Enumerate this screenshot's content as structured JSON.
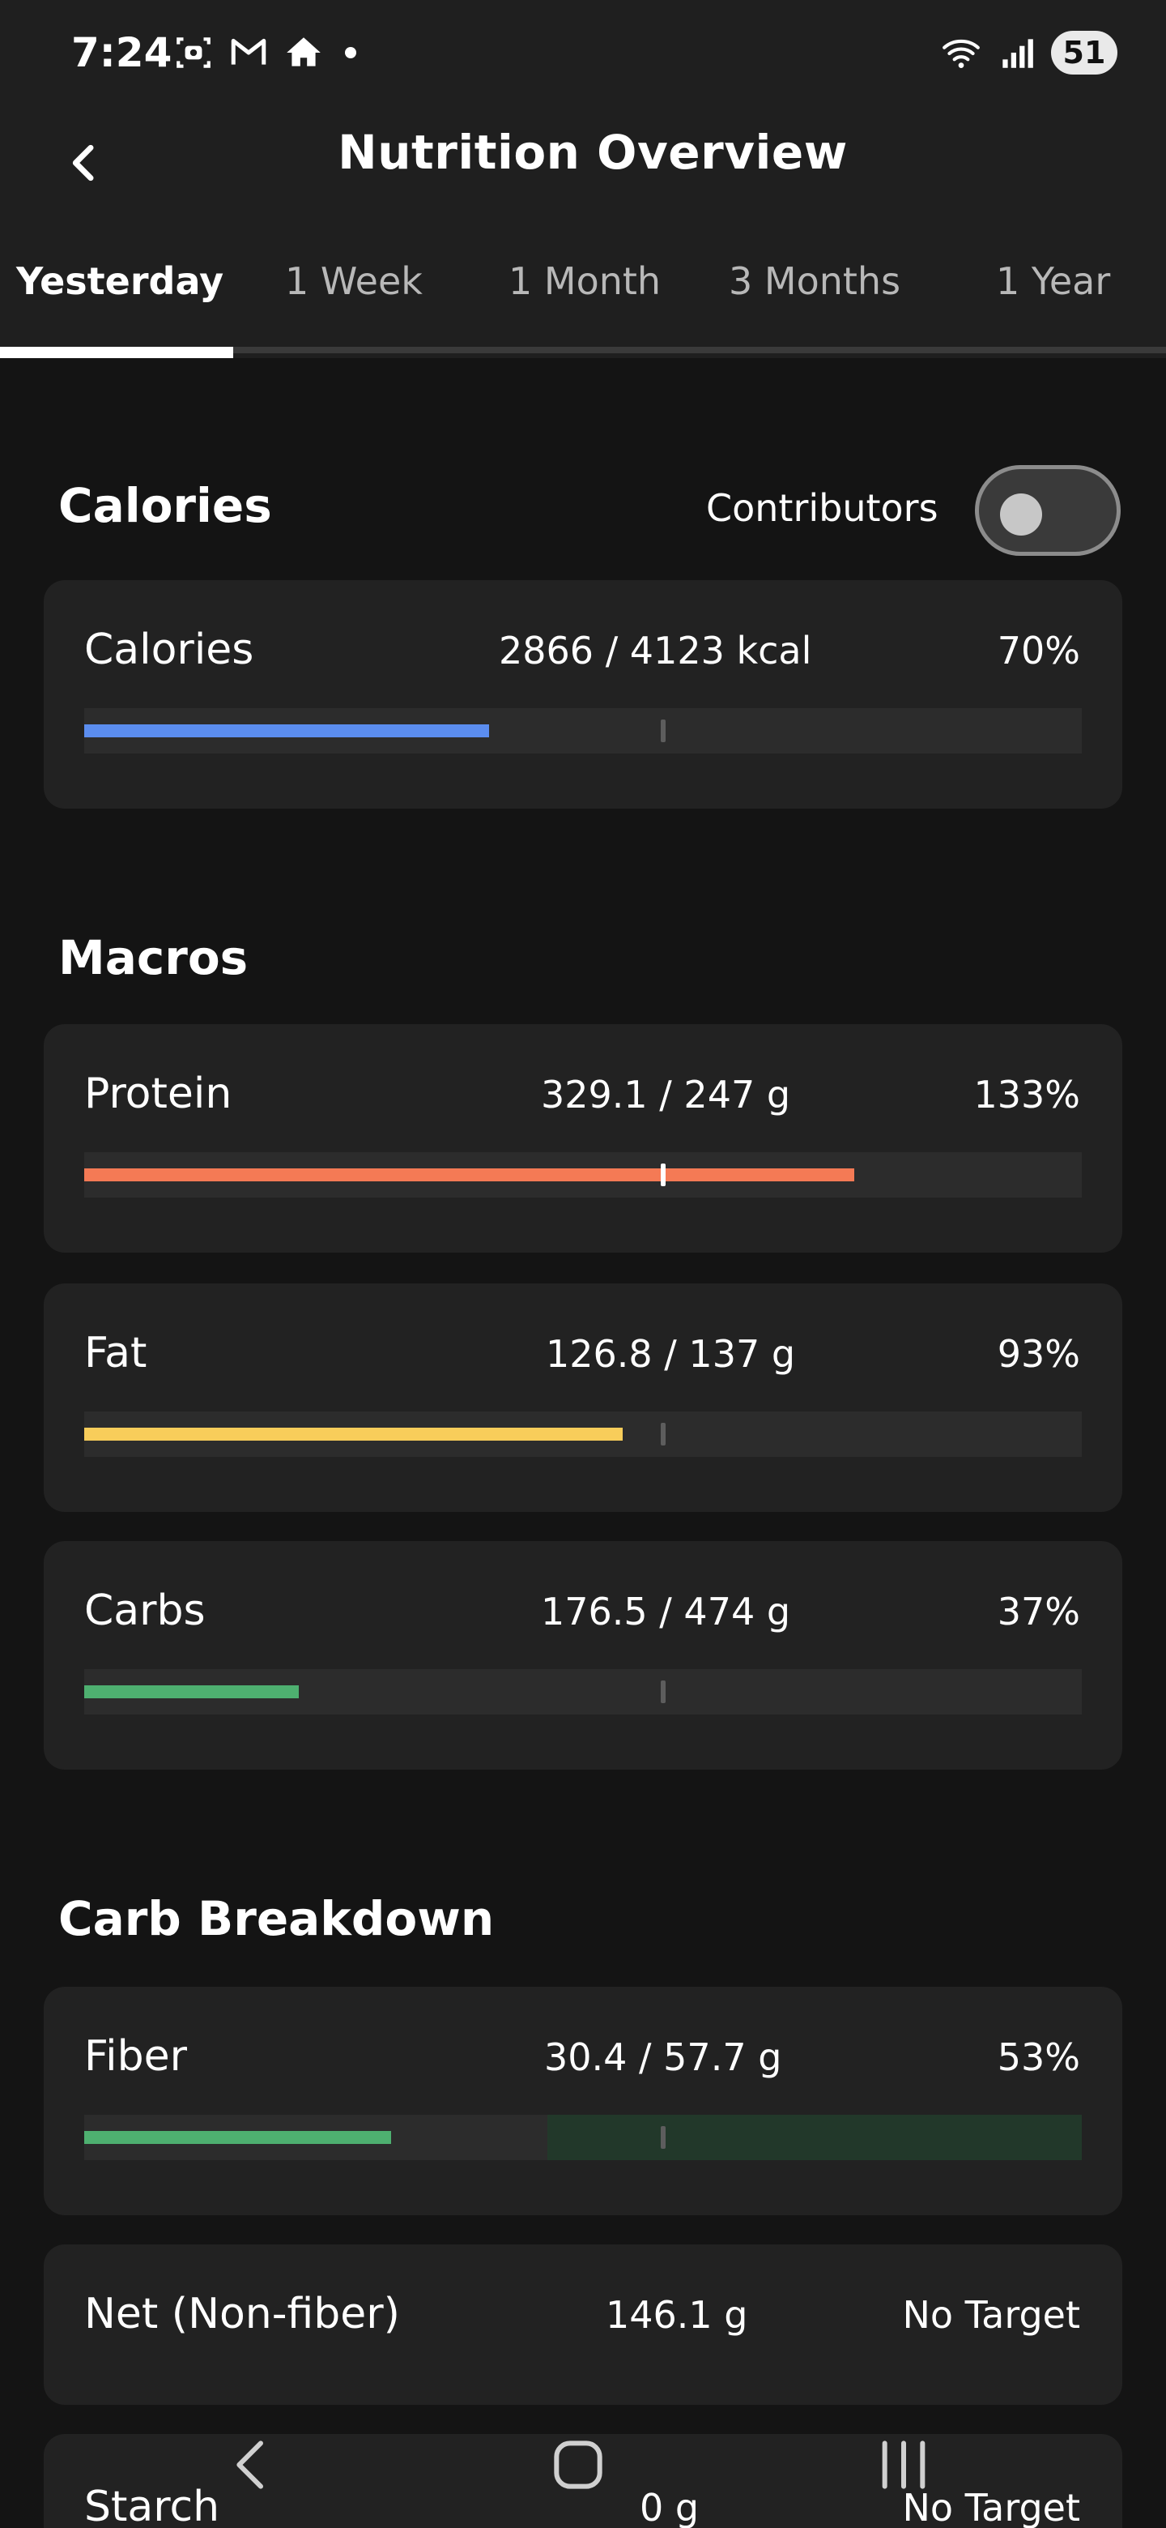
{
  "status_bar": {
    "time": "7:24",
    "left_icons": [
      "screenshot-icon",
      "gmail-icon",
      "home-icon",
      "notification-dot"
    ],
    "right_icons": [
      "wifi-icon",
      "signal-icon"
    ],
    "battery": "51"
  },
  "header": {
    "title": "Nutrition Overview",
    "back_icon": "chevron-left-icon"
  },
  "tabs": [
    {
      "label": "Yesterday",
      "active": true
    },
    {
      "label": "1 Week",
      "active": false
    },
    {
      "label": "1 Month",
      "active": false
    },
    {
      "label": "3 Months",
      "active": false
    },
    {
      "label": "1 Year",
      "active": false
    }
  ],
  "calories_section": {
    "title": "Calories",
    "contributors_label": "Contributors",
    "contributors_on": false,
    "card": {
      "name": "Calories",
      "value": "2866 / 4123 kcal",
      "percent": "70%",
      "fill_fraction": 0.7,
      "color": "#5b8def"
    }
  },
  "macros_section": {
    "title": "Macros",
    "items": [
      {
        "name": "Protein",
        "value": "329.1 / 247 g",
        "percent": "133%",
        "fill_fraction": 1.33,
        "color": "#f47a55"
      },
      {
        "name": "Fat",
        "value": "126.8 / 137 g",
        "percent": "93%",
        "fill_fraction": 0.93,
        "color": "#f8cd5a"
      },
      {
        "name": "Carbs",
        "value": "176.5 / 474 g",
        "percent": "37%",
        "fill_fraction": 0.37,
        "color": "#4eb070"
      }
    ]
  },
  "carb_breakdown": {
    "title": "Carb Breakdown",
    "fiber": {
      "name": "Fiber",
      "value": "30.4 / 57.7 g",
      "percent": "53%",
      "fill_fraction": 0.53,
      "color": "#4eb070",
      "zone_color": "#22382a"
    },
    "rows": [
      {
        "name": "Net (Non-fiber)",
        "value": "146.1 g",
        "status": "No Target"
      },
      {
        "name": "Starch",
        "value": "0 g",
        "status": "No Target"
      }
    ]
  },
  "nav_bar": {
    "icons": [
      "back-nav-icon",
      "home-nav-icon",
      "recents-nav-icon"
    ]
  }
}
